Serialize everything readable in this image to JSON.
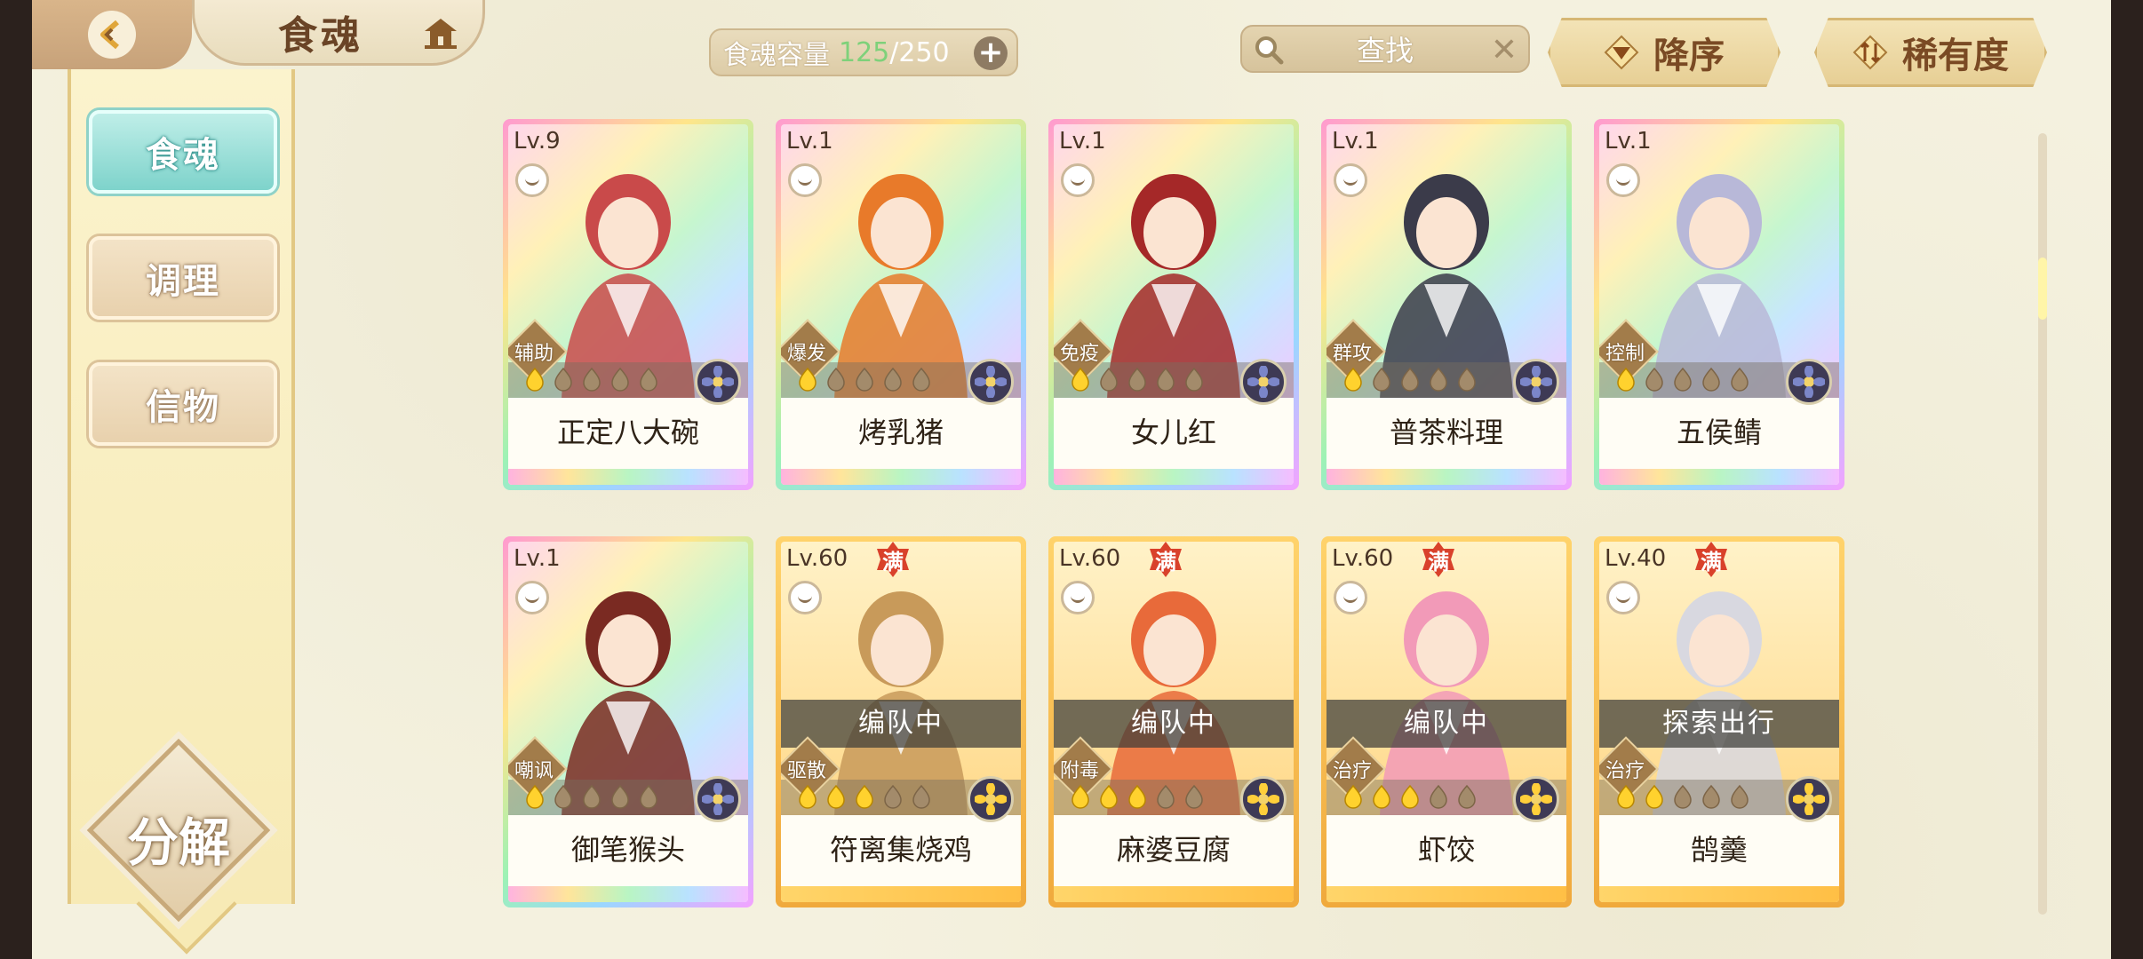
{
  "header": {
    "title": "食魂",
    "capacity": {
      "label": "食魂容量",
      "current": "125",
      "separator": "/",
      "max": "250"
    },
    "search": {
      "placeholder": "查找"
    },
    "sort_order": "降序",
    "sort_key": "稀有度"
  },
  "sidebar": {
    "items": [
      {
        "label": "食魂",
        "active": true
      },
      {
        "label": "调理",
        "active": false
      },
      {
        "label": "信物",
        "active": false
      }
    ],
    "decompose_label": "分解"
  },
  "cards": [
    {
      "level": "Lv.9",
      "name": "正定八大碗",
      "role": "辅助",
      "stars_on": 1,
      "frame": "rainbow",
      "full": "",
      "status": "",
      "accent": "#c94a4a"
    },
    {
      "level": "Lv.1",
      "name": "烤乳猪",
      "role": "爆发",
      "stars_on": 1,
      "frame": "rainbow",
      "full": "",
      "status": "",
      "accent": "#e87a2a"
    },
    {
      "level": "Lv.1",
      "name": "女儿红",
      "role": "免疫",
      "stars_on": 1,
      "frame": "rainbow",
      "full": "",
      "status": "",
      "accent": "#a52828"
    },
    {
      "level": "Lv.1",
      "name": "普茶料理",
      "role": "群攻",
      "stars_on": 1,
      "frame": "rainbow",
      "full": "",
      "status": "",
      "accent": "#3b3b4a"
    },
    {
      "level": "Lv.1",
      "name": "五侯鲭",
      "role": "控制",
      "stars_on": 1,
      "frame": "rainbow",
      "full": "",
      "status": "",
      "accent": "#b8b8d8"
    },
    {
      "level": "Lv.1",
      "name": "御笔猴头",
      "role": "嘲讽",
      "stars_on": 1,
      "frame": "rainbow",
      "full": "",
      "status": "",
      "accent": "#7a2a22"
    },
    {
      "level": "Lv.60",
      "name": "符离集烧鸡",
      "role": "驱散",
      "stars_on": 3,
      "frame": "gold",
      "full": "满",
      "status": "编队中",
      "accent": "#c89a5a"
    },
    {
      "level": "Lv.60",
      "name": "麻婆豆腐",
      "role": "附毒",
      "stars_on": 3,
      "frame": "gold",
      "full": "满",
      "status": "编队中",
      "accent": "#e86a3a"
    },
    {
      "level": "Lv.60",
      "name": "虾饺",
      "role": "治疗",
      "stars_on": 3,
      "frame": "gold",
      "full": "满",
      "status": "编队中",
      "accent": "#f29ab8"
    },
    {
      "level": "Lv.40",
      "name": "鹄羹",
      "role": "治疗",
      "stars_on": 2,
      "frame": "gold",
      "full": "满",
      "status": "探索出行",
      "accent": "#d8d8e0"
    }
  ],
  "colors": {
    "accent_teal": "#7ed3cb",
    "gold": "#f0a93c",
    "capacity_green": "#7ed17a"
  }
}
